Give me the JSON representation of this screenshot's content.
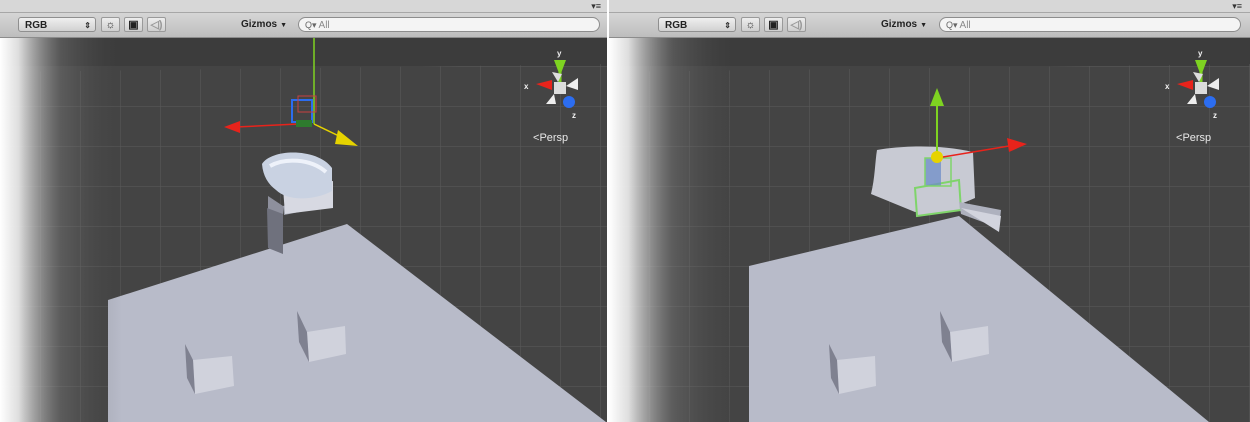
{
  "panels": [
    {
      "toolbar": {
        "render_mode": "RGB",
        "sun_icon": "sun-icon",
        "image_icon": "image-icon",
        "audio_icon": "speaker-icon",
        "gizmos_label": "Gizmos",
        "search_placeholder": "All"
      },
      "orientation_gizmo": {
        "x_label": "x",
        "y_label": "y",
        "z_label": "z"
      },
      "perspective_label": "Persp"
    },
    {
      "toolbar": {
        "render_mode": "RGB",
        "sun_icon": "sun-icon",
        "image_icon": "image-icon",
        "audio_icon": "speaker-icon",
        "gizmos_label": "Gizmos",
        "search_placeholder": "All"
      },
      "orientation_gizmo": {
        "x_label": "x",
        "y_label": "y",
        "z_label": "z"
      },
      "perspective_label": "Persp"
    }
  ],
  "colors": {
    "scene_background": "#434343",
    "grid_line": "#5a5a5a",
    "ground_plane": "#b9bccb",
    "axis_x": "#e8231b",
    "axis_y": "#7ed321",
    "axis_z": "#2c6df0",
    "cone_yellow": "#e6d300"
  }
}
